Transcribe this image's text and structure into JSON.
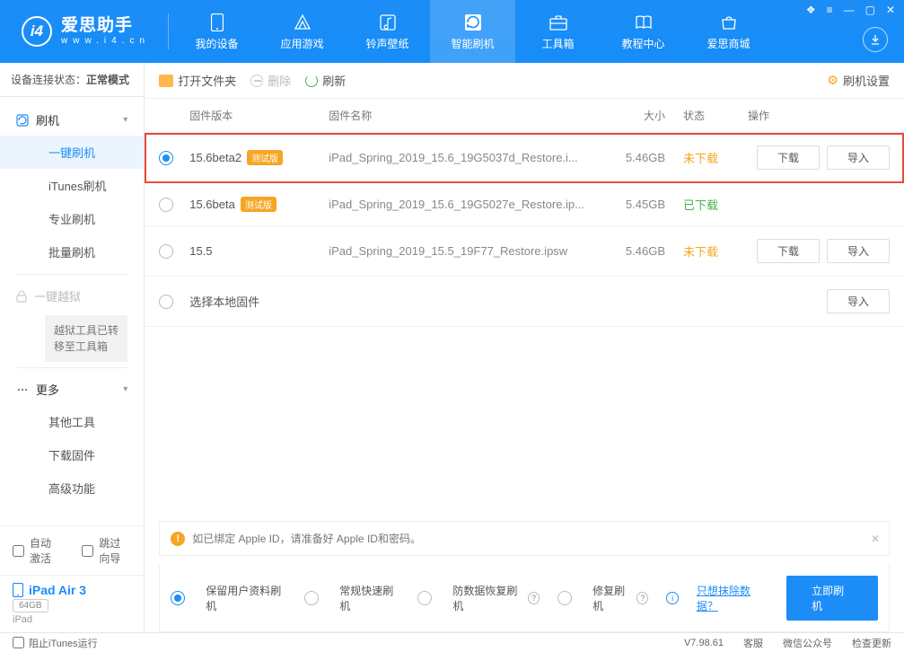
{
  "app": {
    "title": "爱思助手",
    "subtitle": "www.i4.cn"
  },
  "nav": {
    "items": [
      {
        "label": "我的设备"
      },
      {
        "label": "应用游戏"
      },
      {
        "label": "铃声壁纸"
      },
      {
        "label": "智能刷机"
      },
      {
        "label": "工具箱"
      },
      {
        "label": "教程中心"
      },
      {
        "label": "爱思商城"
      }
    ]
  },
  "status": {
    "prefix": "设备连接状态：",
    "mode": "正常模式"
  },
  "sidebar": {
    "flash": {
      "head": "刷机",
      "items": [
        "一键刷机",
        "iTunes刷机",
        "专业刷机",
        "批量刷机"
      ]
    },
    "jailbreak": {
      "head": "一键越狱",
      "note": "越狱工具已转移至工具箱"
    },
    "more": {
      "head": "更多",
      "items": [
        "其他工具",
        "下载固件",
        "高级功能"
      ]
    },
    "auto_activate": "自动激活",
    "skip_guide": "跳过向导",
    "device": {
      "name": "iPad Air 3",
      "storage": "64GB",
      "type": "iPad"
    }
  },
  "toolbar": {
    "open": "打开文件夹",
    "delete": "删除",
    "refresh": "刷新",
    "settings": "刷机设置"
  },
  "table": {
    "headers": {
      "version": "固件版本",
      "name": "固件名称",
      "size": "大小",
      "status": "状态",
      "ops": "操作"
    },
    "rows": [
      {
        "version": "15.6beta2",
        "beta": "测试版",
        "name": "iPad_Spring_2019_15.6_19G5037d_Restore.i...",
        "size": "5.46GB",
        "status": "未下载",
        "status_cls": "st-no",
        "selected": true,
        "highlight": true,
        "show_ops": true
      },
      {
        "version": "15.6beta",
        "beta": "测试版",
        "name": "iPad_Spring_2019_15.6_19G5027e_Restore.ip...",
        "size": "5.45GB",
        "status": "已下载",
        "status_cls": "st-yes",
        "selected": false,
        "highlight": false,
        "show_ops": false
      },
      {
        "version": "15.5",
        "beta": "",
        "name": "iPad_Spring_2019_15.5_19F77_Restore.ipsw",
        "size": "5.46GB",
        "status": "未下载",
        "status_cls": "st-no",
        "selected": false,
        "highlight": false,
        "show_ops": true
      }
    ],
    "local_row": "选择本地固件",
    "btn_download": "下载",
    "btn_import": "导入"
  },
  "notice": "如已绑定 Apple ID，请准备好 Apple ID和密码。",
  "options": {
    "items": [
      "保留用户资料刷机",
      "常规快速刷机",
      "防数据恢复刷机",
      "修复刷机"
    ],
    "erase_link": "只想抹除数据？",
    "flash_now": "立即刷机"
  },
  "footer": {
    "block_itunes": "阻止iTunes运行",
    "version": "V7.98.61",
    "service": "客服",
    "wechat": "微信公众号",
    "update": "检查更新"
  }
}
